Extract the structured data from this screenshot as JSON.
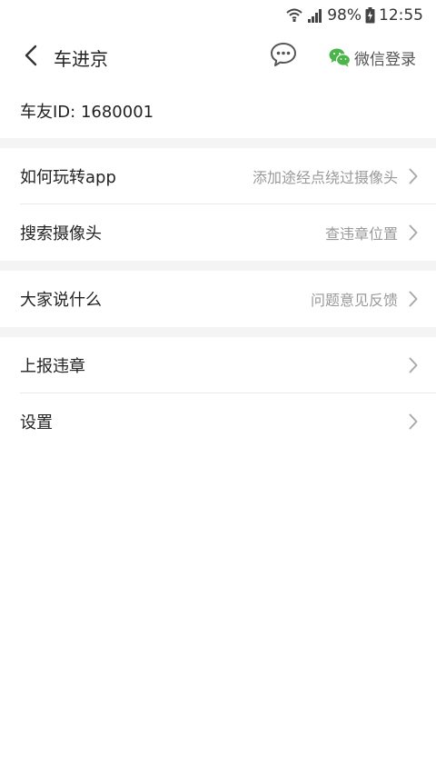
{
  "status_bar": {
    "battery": "98%",
    "time": "12:55",
    "icons": [
      "wifi-icon",
      "signal-icon",
      "battery-icon"
    ]
  },
  "nav": {
    "title": "车进京",
    "back_icon": "chevron-left-icon",
    "chat_icon": "chat-bubble-icon",
    "wechat_icon": "wechat-icon",
    "wechat_login_label": "微信登录"
  },
  "user": {
    "id_text": "车友ID: 1680001"
  },
  "menu": {
    "group1": [
      {
        "label": "如何玩转app",
        "hint": "添加途经点绕过摄像头"
      },
      {
        "label": "搜索摄像头",
        "hint": "查违章位置"
      }
    ],
    "group2": [
      {
        "label": "大家说什么",
        "hint": "问题意见反馈"
      }
    ],
    "group3": [
      {
        "label": "上报违章",
        "hint": ""
      },
      {
        "label": "设置",
        "hint": ""
      }
    ]
  },
  "colors": {
    "wechat_green": "#4cb54a",
    "divider_band": "#f4f4f4",
    "hint_text": "#999999"
  }
}
